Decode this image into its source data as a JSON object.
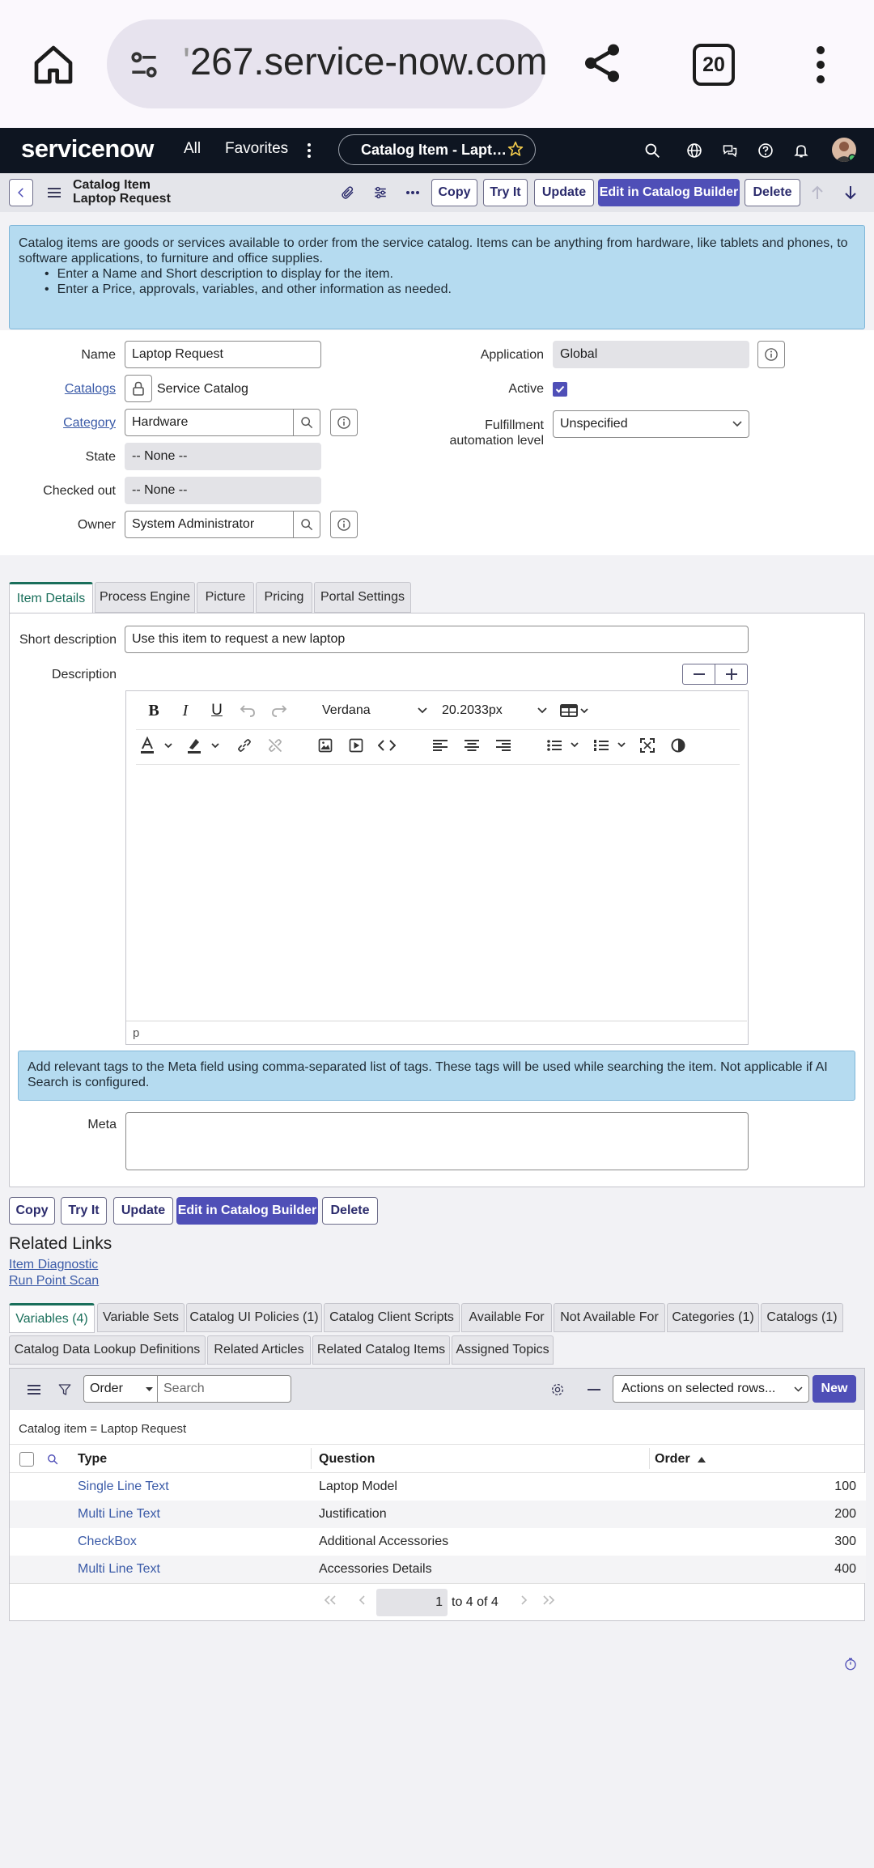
{
  "browser": {
    "url": "267.service-now.com",
    "url_prefix": "'",
    "tab_count": "20"
  },
  "app": {
    "logo": "servicenow",
    "nav_all": "All",
    "nav_favorites": "Favorites",
    "crumb": "Catalog Item - Lapt…"
  },
  "form_header": {
    "title_line1": "Catalog Item",
    "title_line2": "Laptop Request",
    "buttons": [
      "Copy",
      "Try It",
      "Update",
      "Edit in Catalog Builder",
      "Delete"
    ]
  },
  "info_text": "Catalog items are goods or services available to order from the service catalog. Items can be anything from hardware, like tablets and phones, to software applications, to furniture and office supplies.",
  "info_bullets": [
    "Enter a Name and Short description to display for the item.",
    "Enter a Price, approvals, variables, and other information as needed."
  ],
  "fields": {
    "name_label": "Name",
    "name_value": "Laptop Request",
    "catalogs_label": "Catalogs",
    "catalogs_value": "Service Catalog",
    "category_label": "Category",
    "category_value": "Hardware",
    "state_label": "State",
    "state_value": "-- None --",
    "checked_out_label": "Checked out",
    "checked_out_value": "-- None --",
    "owner_label": "Owner",
    "owner_value": "System Administrator",
    "application_label": "Application",
    "application_value": "Global",
    "active_label": "Active",
    "fulfillment_label_1": "Fulfillment",
    "fulfillment_label_2": "automation level",
    "fulfillment_value": "Unspecified"
  },
  "tabs": [
    "Item Details",
    "Process Engine",
    "Picture",
    "Pricing",
    "Portal Settings"
  ],
  "item_details": {
    "short_desc_label": "Short description",
    "short_desc_value": "Use this item to request a new laptop",
    "description_label": "Description",
    "font_family": "Verdana",
    "font_size": "20.2033px",
    "status_path": "p",
    "meta_info": "Add relevant tags to the Meta field using comma-separated list of tags. These tags will be used while searching the item. Not applicable if AI Search is configured.",
    "meta_label": "Meta"
  },
  "bottom_buttons": [
    "Copy",
    "Try It",
    "Update",
    "Edit in Catalog Builder",
    "Delete"
  ],
  "related_links": {
    "title": "Related Links",
    "links": [
      "Item Diagnostic",
      "Run Point Scan"
    ]
  },
  "related_tabs_row1": [
    "Variables (4)",
    "Variable Sets",
    "Catalog UI Policies (1)",
    "Catalog Client Scripts",
    "Available For",
    "Not Available For",
    "Categories (1)",
    "Catalogs (1)"
  ],
  "related_tabs_row2": [
    "Catalog Data Lookup Definitions",
    "Related Articles",
    "Related Catalog Items",
    "Assigned Topics"
  ],
  "list": {
    "search_field": "Order",
    "search_placeholder": "Search",
    "actions_select": "Actions on selected rows...",
    "new_button": "New",
    "filter_text": "Catalog item = Laptop Request",
    "columns": [
      "Type",
      "Question",
      "Order"
    ],
    "rows": [
      {
        "type": "Single Line Text",
        "question": "Laptop Model",
        "order": "100"
      },
      {
        "type": "Multi Line Text",
        "question": "Justification",
        "order": "200"
      },
      {
        "type": "CheckBox",
        "question": "Additional Accessories",
        "order": "300"
      },
      {
        "type": "Multi Line Text",
        "question": "Accessories Details",
        "order": "400"
      }
    ],
    "page_value": "1",
    "page_range": "to 4 of 4"
  },
  "colors": {
    "primary": "#4f4fb7",
    "header_bg": "#0e1521",
    "info_bg": "#b5dbf0",
    "link": "#3b5ba8",
    "tab_accent": "#1a6f5b"
  }
}
